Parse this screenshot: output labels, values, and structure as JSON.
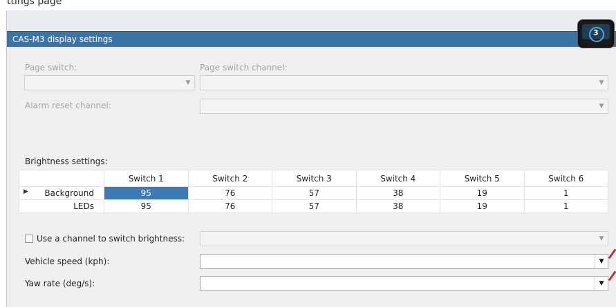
{
  "page_top_text": "ttings page",
  "window": {
    "title": "CAS-M3 display settings"
  },
  "page_switch": {
    "label": "Page switch:",
    "value": ""
  },
  "page_switch_channel": {
    "label": "Page switch channel:",
    "value": ""
  },
  "alarm_reset_channel": {
    "label": "Alarm reset channel:",
    "value": ""
  },
  "brightness": {
    "label": "Brightness settings:",
    "columns": [
      "Switch 1",
      "Switch 2",
      "Switch 3",
      "Switch 4",
      "Switch 5",
      "Switch 6"
    ],
    "rows": [
      {
        "name": "Background",
        "values": [
          "95",
          "76",
          "57",
          "38",
          "19",
          "1"
        ]
      },
      {
        "name": "LEDs",
        "values": [
          "95",
          "76",
          "57",
          "38",
          "19",
          "1"
        ]
      }
    ]
  },
  "use_channel_brightness": {
    "label": "Use a channel to switch brightness:",
    "checked": false,
    "value": ""
  },
  "vehicle_speed": {
    "label": "Vehicle speed (kph):",
    "value": ""
  },
  "yaw_rate": {
    "label": "Yaw rate (deg/s):",
    "value": ""
  },
  "colors": {
    "title_bar": "#3c74a7",
    "selection": "#3d7ab8",
    "panel": "#f0f0f0"
  }
}
